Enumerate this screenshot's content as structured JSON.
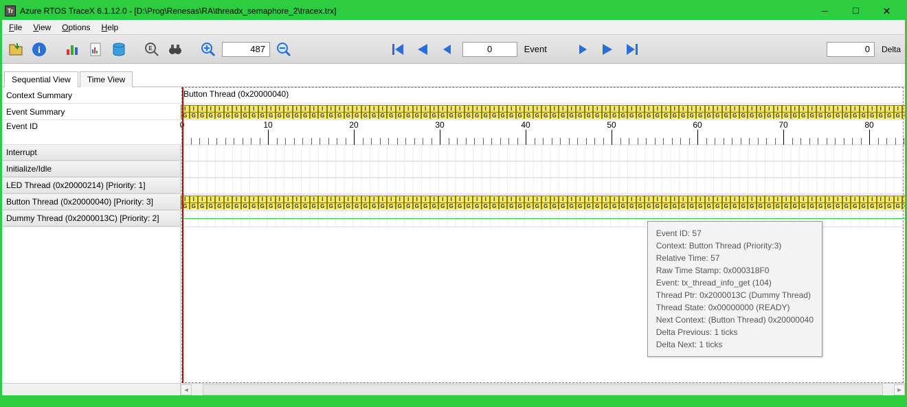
{
  "window": {
    "app_icon_text": "Tr",
    "title": "Azure RTOS TraceX 6.1.12.0 - [D:\\Prog\\Renesas\\RA\\threadx_semaphore_2\\tracex.trx]"
  },
  "menu": {
    "file": "File",
    "view": "View",
    "options": "Options",
    "help": "Help"
  },
  "toolbar": {
    "zoom_value": "487",
    "event_value": "0",
    "event_label": "Event",
    "delta_value": "0",
    "delta_label": "Delta"
  },
  "tabs": {
    "sequential": "Sequential View",
    "time": "Time View"
  },
  "rows": {
    "context_summary": "Context Summary",
    "event_summary": "Event Summary",
    "event_id": "Event ID",
    "interrupt": "Interrupt",
    "init_idle": "Initialize/Idle",
    "led_thread": "LED Thread (0x20000214) [Priority: 1]",
    "button_thread_lab": "Button Thread (0x20000040) [Priority: 3]",
    "dummy_thread": "Dummy Thread (0x2000013C) [Priority: 2]",
    "button_thread_header": "Button Thread (0x20000040)"
  },
  "ruler_labels": [
    "0",
    "10",
    "20",
    "30",
    "40",
    "50",
    "60",
    "70",
    "80"
  ],
  "tooltip": {
    "l1": "Event ID:  57",
    "l2": "Context:   Button Thread (Priority:3)",
    "l3": "Relative Time:   57",
    "l4": "Raw Time Stamp:   0x000318F0",
    "l5": "Event:   tx_thread_info_get (104)",
    "l6": "Thread Ptr:   0x2000013C (Dummy Thread)",
    "l7": "Thread State:   0x00000000 (READY)",
    "l8": "Next Context:    (Button Thread) 0x20000040",
    "l9": "Delta Previous:   1 ticks",
    "l10": "Delta Next:   1 ticks"
  }
}
